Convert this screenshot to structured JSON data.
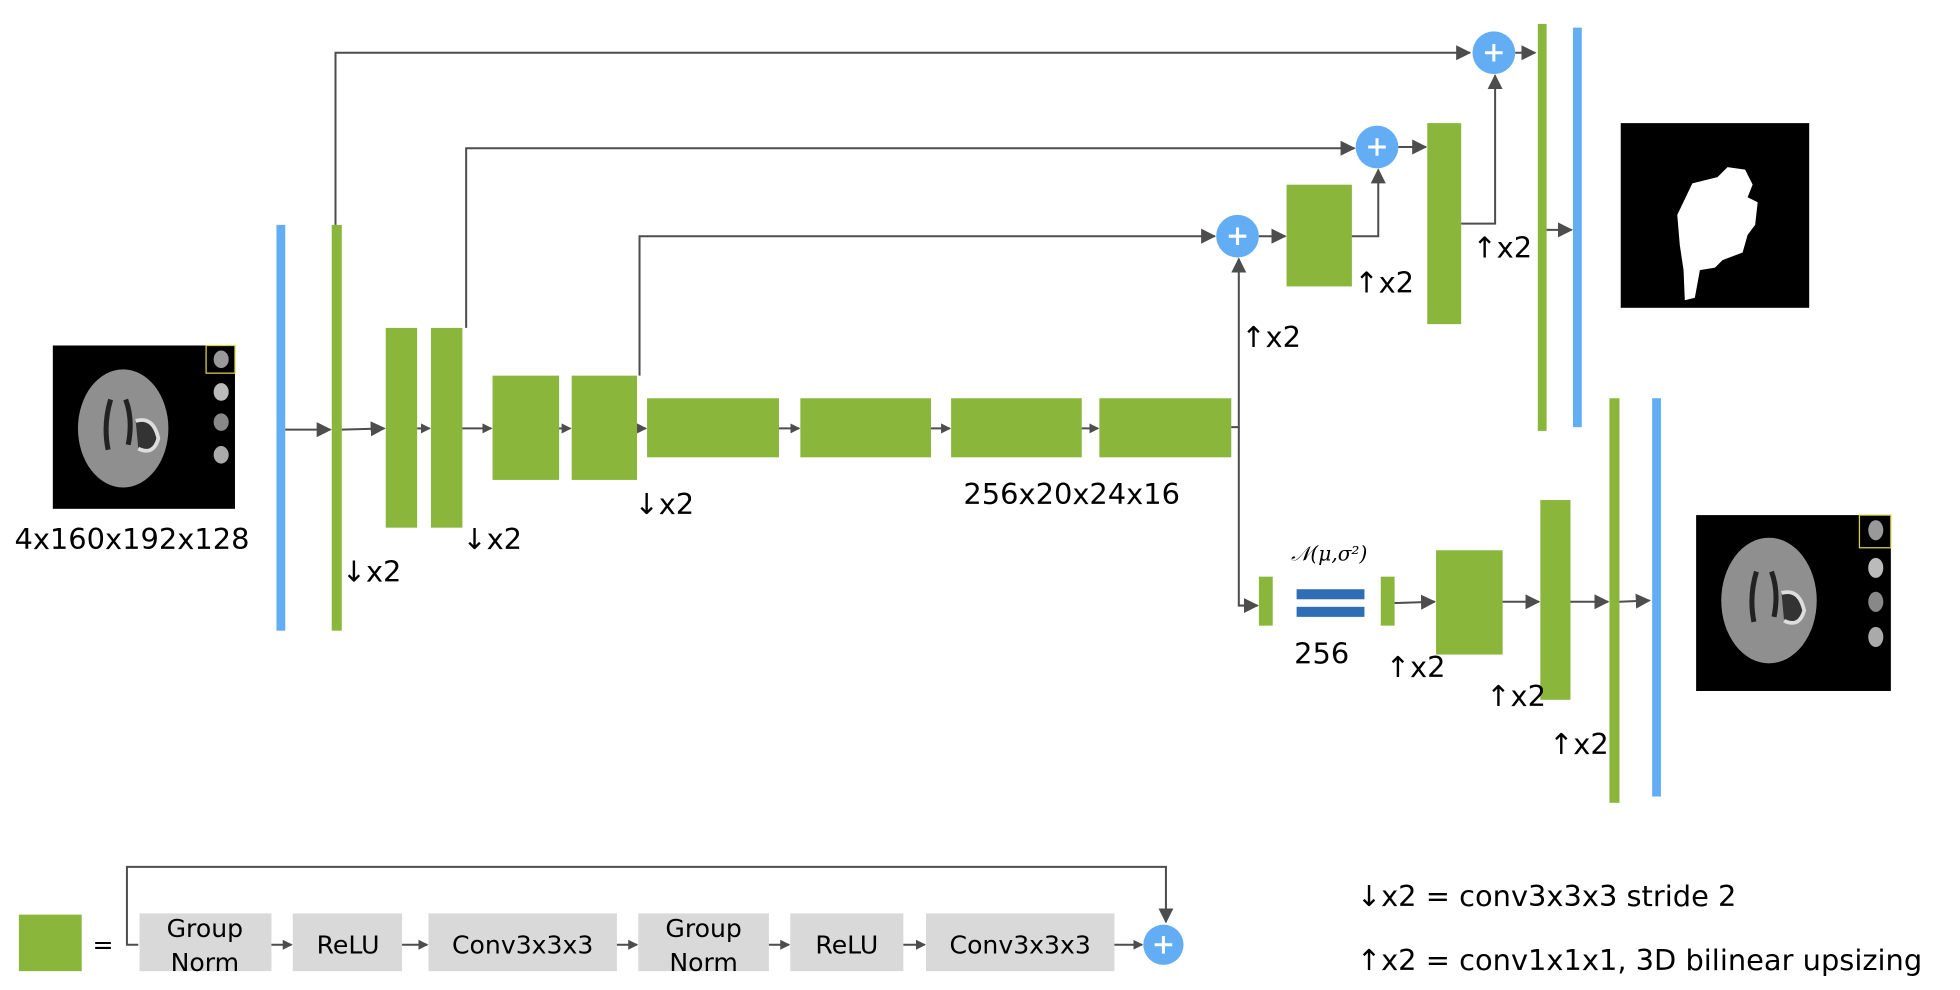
{
  "colors": {
    "block": "#8ab63b",
    "feature": "#63adf5",
    "arrow": "#4d4d4d",
    "latent": "#2f6eb5",
    "op_box": "#d9d9d9"
  },
  "input": {
    "shape_label": "4x160x192x128"
  },
  "encoder": {
    "downsample_labels": [
      "↓x2",
      "↓x2",
      "↓x2"
    ],
    "bottleneck_label": "256x20x24x16"
  },
  "decoder": {
    "upsample_labels": [
      "↑x2",
      "↑x2",
      "↑x2"
    ]
  },
  "vae": {
    "distribution_label": "𝒩(μ,σ²)",
    "latent_size": "256",
    "upsample_labels": [
      "↑x2",
      "↑x2",
      "↑x2"
    ]
  },
  "legend": {
    "equals": "=",
    "ops": [
      {
        "line1": "Group",
        "line2": "Norm"
      },
      {
        "line1": "ReLU"
      },
      {
        "line1": "Conv3x3x3"
      },
      {
        "line1": "Group",
        "line2": "Norm"
      },
      {
        "line1": "ReLU"
      },
      {
        "line1": "Conv3x3x3"
      }
    ],
    "down_def": "↓x2 = conv3x3x3 stride 2",
    "up_def": "↑x2 = conv1x1x1, 3D bilinear upsizing"
  }
}
